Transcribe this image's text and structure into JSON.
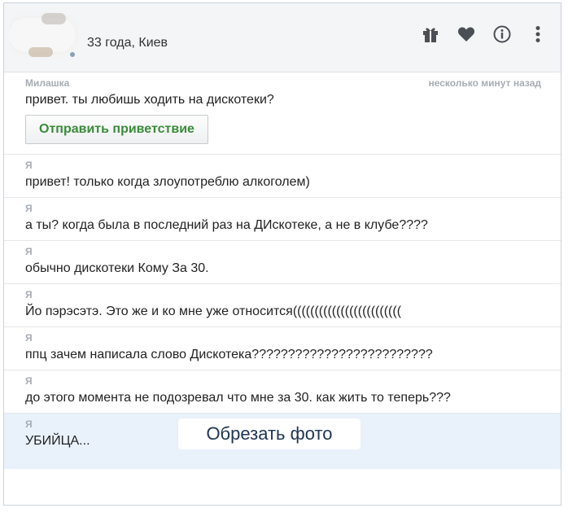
{
  "header": {
    "profile_info": "33 года, Киев",
    "icons": [
      "gift-icon",
      "heart-icon",
      "info-icon",
      "more-vertical-icon"
    ]
  },
  "first_message": {
    "sender": "Милашка",
    "time": "несколько минут назад",
    "text": "привет. ты любишь ходить на дискотеки?",
    "greet_button": "Отправить приветствие"
  },
  "messages": [
    {
      "sender": "Я",
      "text": "привет! только когда злоупотреблю алкоголем)"
    },
    {
      "sender": "Я",
      "text": "а ты? когда была в последний раз на ДИскотеке, а не в клубе????"
    },
    {
      "sender": "Я",
      "text": "обычно дискотеки Кому За 30."
    },
    {
      "sender": "Я",
      "text": "Йо пэрэсэтэ. Это же и ко мне уже относится((((((((((((((((((((((((("
    },
    {
      "sender": "Я",
      "text": "ппц зачем написала слово Дискотека?????????????????????????"
    },
    {
      "sender": "Я",
      "text": "до этого момента не подозревал что мне за 30. как жить то теперь???"
    }
  ],
  "last_message": {
    "sender": "Я",
    "text": "УБИЙЦА...",
    "crop_button": "Обрезать фото"
  },
  "colors": {
    "accent_green": "#3a8b39",
    "highlight_bg": "#e9f1fb",
    "icon_color": "#4a4f55"
  }
}
